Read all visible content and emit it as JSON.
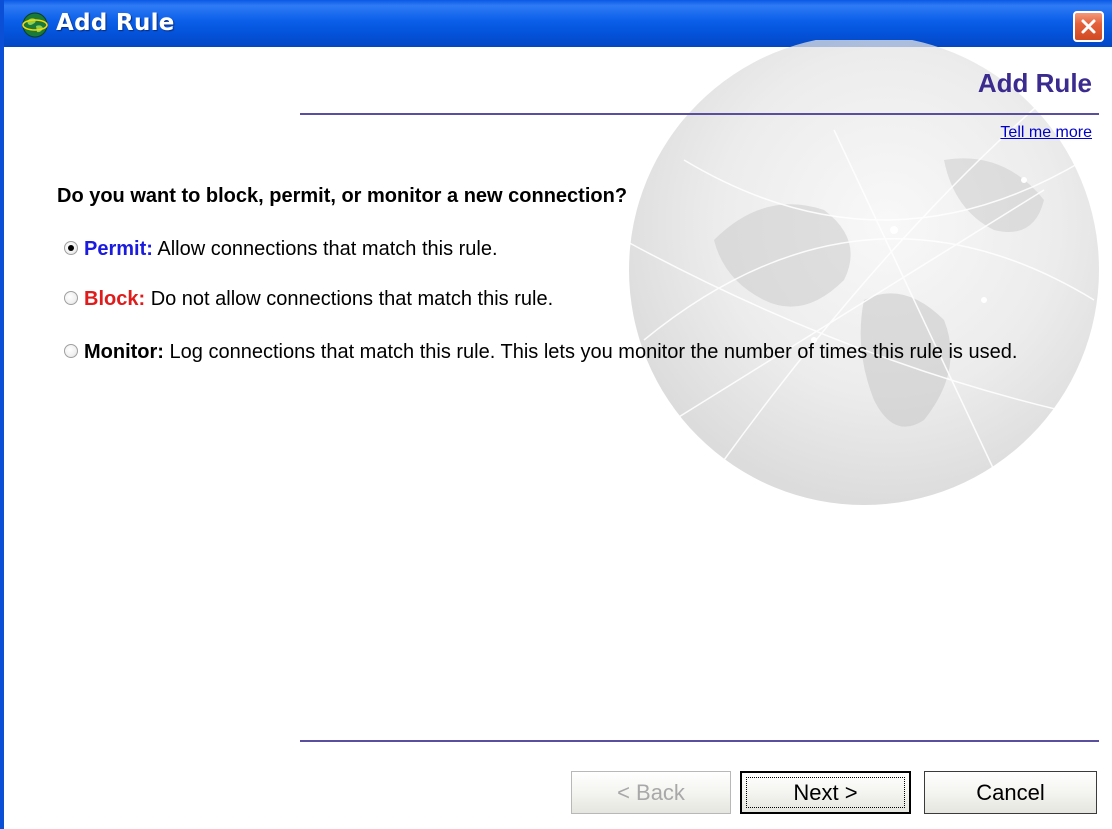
{
  "window": {
    "title": "Add Rule"
  },
  "header": {
    "title": "Add Rule",
    "help_link": "Tell me more"
  },
  "question": "Do you want to block, permit, or monitor a new connection?",
  "options": [
    {
      "label": "Permit:",
      "description": "Allow connections that match this rule.",
      "selected": true
    },
    {
      "label": "Block:",
      "description": "Do not allow connections that match this rule.",
      "selected": false
    },
    {
      "label": "Monitor:",
      "description": "Log connections that match this rule. This lets you monitor the number of times this rule is used.",
      "selected": false
    }
  ],
  "buttons": {
    "back": "< Back",
    "next": "Next >",
    "cancel": "Cancel"
  },
  "colors": {
    "titlebar": "#0a5ee8",
    "header_title": "#3b2b8f",
    "permit": "#1b1be0",
    "block": "#e01b1b",
    "link": "#0000cc"
  }
}
